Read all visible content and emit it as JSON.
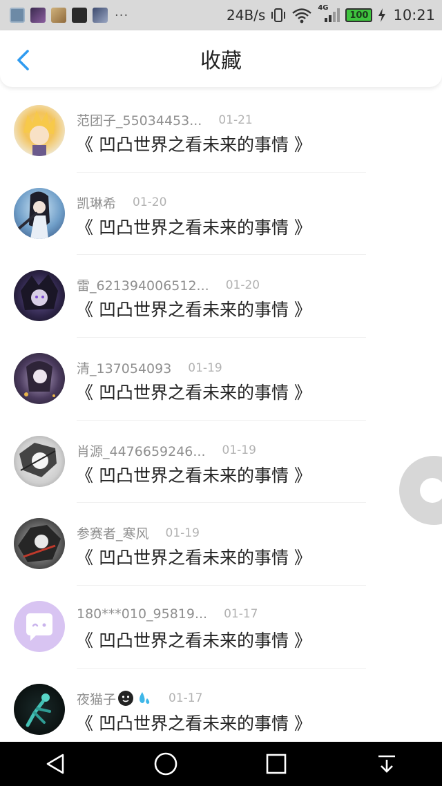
{
  "status_bar": {
    "more": "···",
    "speed": "24B/s",
    "network": "4G",
    "battery": "100",
    "time": "10:21"
  },
  "header": {
    "title": "收藏"
  },
  "items": [
    {
      "user": "范团子_55034453...",
      "date": "01-21",
      "title": "《 凹凸世界之看未来的事情 》"
    },
    {
      "user": "凯琳希",
      "date": "01-20",
      "title": "《 凹凸世界之看未来的事情 》"
    },
    {
      "user": "雷_621394006512...",
      "date": "01-20",
      "title": "《 凹凸世界之看未来的事情 》"
    },
    {
      "user": "清_137054093",
      "date": "01-19",
      "title": "《 凹凸世界之看未来的事情 》"
    },
    {
      "user": "肖源_4476659246...",
      "date": "01-19",
      "title": "《 凹凸世界之看未来的事情 》"
    },
    {
      "user": "参赛者_寒风",
      "date": "01-19",
      "title": "《 凹凸世界之看未来的事情 》"
    },
    {
      "user": "180***010_95819...",
      "date": "01-17",
      "title": "《 凹凸世界之看未来的事情 》"
    },
    {
      "user": "夜猫子",
      "date": "01-17",
      "title": "《 凹凸世界之看未来的事情 》"
    }
  ],
  "colors": {
    "accent": "#2f9bf0",
    "status_bar_bg": "#d9d9d9",
    "nav_bar_bg": "#000000"
  }
}
